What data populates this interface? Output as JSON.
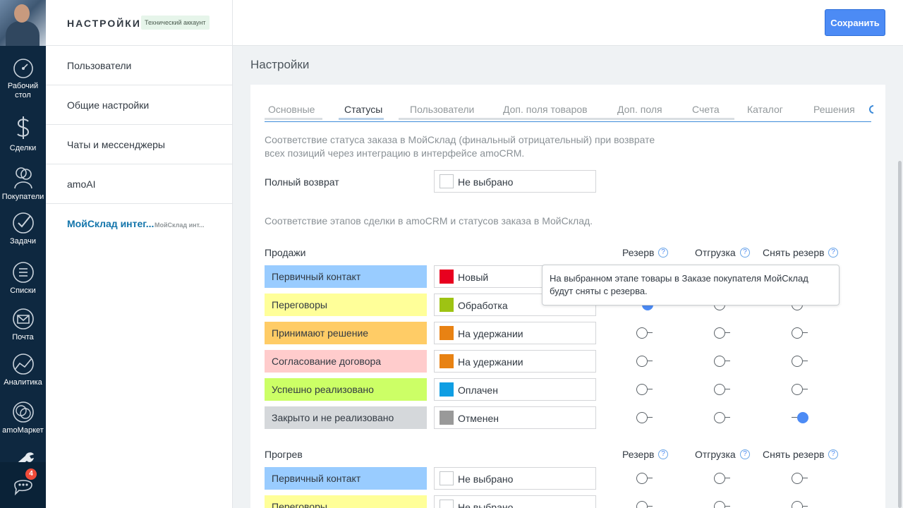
{
  "nav": {
    "items": [
      {
        "label": "Рабочий стол",
        "icon": "dashboard-icon"
      },
      {
        "label": "Сделки",
        "icon": "dollar-icon"
      },
      {
        "label": "Покупатели",
        "icon": "customers-icon"
      },
      {
        "label": "Задачи",
        "icon": "check-icon"
      },
      {
        "label": "Списки",
        "icon": "list-icon"
      },
      {
        "label": "Почта",
        "icon": "mail-icon"
      },
      {
        "label": "Аналитика",
        "icon": "analytics-icon"
      },
      {
        "label": "amoМаркет",
        "icon": "market-icon"
      }
    ],
    "chat_badge": "4"
  },
  "sidebar": {
    "title": "НАСТРОЙКИ",
    "badge": "Технический аккаунт",
    "items": [
      {
        "label": "Пользователи"
      },
      {
        "label": "Общие настройки"
      },
      {
        "label": "Чаты и мессенджеры"
      },
      {
        "label": "amoAI"
      },
      {
        "label": "МойСклад интег...",
        "sub": "МойСклад инт..."
      }
    ]
  },
  "toolbar": {
    "save_label": "Сохранить"
  },
  "page": {
    "title": "Настройки"
  },
  "tabs": [
    "Основные",
    "Статусы",
    "Пользователи",
    "Доп. поля товаров",
    "Доп. поля",
    "Счета",
    "Каталог",
    "Решения"
  ],
  "active_tab": "Статусы",
  "return_desc": {
    "line1": "Соответствие статуса заказа в МойСклад (финальный отрицательный) при возврате",
    "line2": "всех позиций через интеграцию в интерфейсе amoCRM."
  },
  "full_return": {
    "label": "Полный возврат",
    "value": "Не выбрано"
  },
  "mapping_desc": "Соответствие этапов сделки в amoCRM и статусов заказа в МойСклад.",
  "columns": {
    "reserve": "Резерв",
    "shipment": "Отгрузка",
    "unreserve": "Снять резерв",
    "help": "?"
  },
  "pipelines": [
    {
      "name": "Продажи",
      "rows": [
        {
          "stage": "Первичный контакт",
          "stage_color": "#99ccff",
          "status": "Новый",
          "status_color": "#e8001f",
          "reserve": false,
          "shipment": false,
          "unreserve": false
        },
        {
          "stage": "Переговоры",
          "stage_color": "#ffff99",
          "status": "Обработка",
          "status_color": "#9ec313",
          "reserve": true,
          "shipment": false,
          "unreserve": false
        },
        {
          "stage": "Принимают решение",
          "stage_color": "#ffcc66",
          "status": "На удержании",
          "status_color": "#e88213",
          "reserve": false,
          "shipment": false,
          "unreserve": false
        },
        {
          "stage": "Согласование договора",
          "stage_color": "#ffcccc",
          "status": "На удержании",
          "status_color": "#e88213",
          "reserve": false,
          "shipment": false,
          "unreserve": false
        },
        {
          "stage": "Успешно реализовано",
          "stage_color": "#ccff66",
          "status": "Оплачен",
          "status_color": "#0f9ee3",
          "reserve": false,
          "shipment": false,
          "unreserve": false
        },
        {
          "stage": "Закрыто и не реализовано",
          "stage_color": "#d5d8db",
          "status": "Отменен",
          "status_color": "#999999",
          "reserve": false,
          "shipment": false,
          "unreserve": true
        }
      ]
    },
    {
      "name": "Прогрев",
      "rows": [
        {
          "stage": "Первичный контакт",
          "stage_color": "#99ccff",
          "status": "Не выбрано",
          "status_color": "",
          "reserve": false,
          "shipment": false,
          "unreserve": false
        },
        {
          "stage": "Переговоры",
          "stage_color": "#ffff99",
          "status": "Не выбрано",
          "status_color": "",
          "reserve": false,
          "shipment": false,
          "unreserve": false
        }
      ]
    }
  ],
  "tooltip": {
    "line1": "На выбранном этапе товары в Заказе покупателя МойСклад",
    "line2": "будут сняты с резерва."
  },
  "colors": {
    "accent": "#4c8bf5",
    "nav_bg": "#0e2840",
    "active_link": "#1375ab"
  }
}
